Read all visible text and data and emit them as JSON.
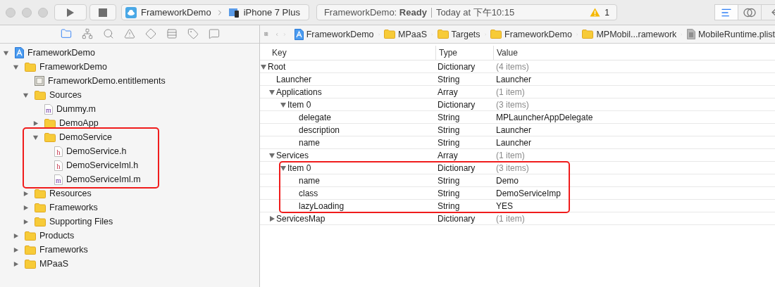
{
  "toolbar": {
    "scheme": "FrameworkDemo",
    "device": "iPhone 7 Plus",
    "status": "FrameworkDemo: **Ready**",
    "time": "Today at 下午10:15",
    "warnings": "1",
    "editor_modes": [
      {
        "kind": "standard",
        "selected": true
      },
      {
        "kind": "assistant",
        "selected": false
      },
      {
        "kind": "version",
        "selected": false
      }
    ]
  },
  "navigator_tabs": [
    {
      "kind": "project",
      "selected": true
    },
    {
      "kind": "symbol",
      "selected": false
    },
    {
      "kind": "find",
      "selected": false
    },
    {
      "kind": "issue",
      "selected": false
    },
    {
      "kind": "test",
      "selected": false
    },
    {
      "kind": "debug",
      "selected": false
    },
    {
      "kind": "breakpoint",
      "selected": false
    },
    {
      "kind": "report",
      "selected": false
    }
  ],
  "tree": [
    {
      "label": "FrameworkDemo",
      "kind": "project",
      "expanded": true,
      "highlighted": false,
      "children": [
        {
          "label": "FrameworkDemo",
          "kind": "folder",
          "expanded": true,
          "highlighted": false,
          "children": [
            {
              "label": "FrameworkDemo.entitlements",
              "kind": "entitlements",
              "highlighted": false
            },
            {
              "label": "Sources",
              "kind": "folder",
              "expanded": true,
              "highlighted": false,
              "children": [
                {
                  "label": "Dummy.m",
                  "kind": "source",
                  "letter": "m",
                  "highlighted": false
                },
                {
                  "label": "DemoApp",
                  "kind": "folder",
                  "expanded": false,
                  "highlighted": false
                },
                {
                  "label": "DemoService",
                  "kind": "folder",
                  "expanded": true,
                  "highlighted": true,
                  "children": [
                    {
                      "label": "DemoService.h",
                      "kind": "header",
                      "letter": "h",
                      "highlighted": false
                    },
                    {
                      "label": "DemoServiceIml.h",
                      "kind": "header",
                      "letter": "h",
                      "highlighted": false
                    },
                    {
                      "label": "DemoServiceIml.m",
                      "kind": "source",
                      "letter": "m",
                      "highlighted": false
                    }
                  ]
                }
              ]
            },
            {
              "label": "Resources",
              "kind": "folder",
              "expanded": false,
              "highlighted": false
            },
            {
              "label": "Frameworks",
              "kind": "folder",
              "expanded": false,
              "highlighted": false
            },
            {
              "label": "Supporting Files",
              "kind": "folder",
              "expanded": false,
              "highlighted": false
            }
          ]
        },
        {
          "label": "Products",
          "kind": "folder",
          "expanded": false,
          "highlighted": false
        },
        {
          "label": "Frameworks",
          "kind": "folder",
          "expanded": false,
          "highlighted": false
        },
        {
          "label": "MPaaS",
          "kind": "folder",
          "expanded": false,
          "highlighted": false
        }
      ]
    }
  ],
  "breadcrumb": [
    {
      "label": "FrameworkDemo",
      "kind": "project"
    },
    {
      "label": "MPaaS",
      "kind": "folder"
    },
    {
      "label": "Targets",
      "kind": "folder"
    },
    {
      "label": "FrameworkDemo",
      "kind": "folder"
    },
    {
      "label": "MPMobil...ramework",
      "kind": "folder"
    },
    {
      "label": "MobileRuntime.plist",
      "kind": "plist"
    }
  ],
  "plist": {
    "columns": [
      "Key",
      "Type",
      "Value"
    ],
    "rows": [
      {
        "key": "Root",
        "type": "Dictionary",
        "value": "(4 items)",
        "kind": "collection",
        "expanded": true,
        "highlighted": false,
        "children": [
          {
            "key": "Launcher",
            "type": "String",
            "value": "Launcher",
            "kind": "value",
            "highlighted": false
          },
          {
            "key": "Applications",
            "type": "Array",
            "value": "(1 item)",
            "kind": "collection",
            "expanded": true,
            "highlighted": false,
            "children": [
              {
                "key": "Item 0",
                "type": "Dictionary",
                "value": "(3 items)",
                "kind": "collection",
                "expanded": true,
                "highlighted": false,
                "children": [
                  {
                    "key": "delegate",
                    "type": "String",
                    "value": "MPLauncherAppDelegate",
                    "kind": "value",
                    "highlighted": false
                  },
                  {
                    "key": "description",
                    "type": "String",
                    "value": "Launcher",
                    "kind": "value",
                    "highlighted": false
                  },
                  {
                    "key": "name",
                    "type": "String",
                    "value": "Launcher",
                    "kind": "value",
                    "highlighted": false
                  }
                ]
              }
            ]
          },
          {
            "key": "Services",
            "type": "Array",
            "value": "(1 item)",
            "kind": "collection",
            "expanded": true,
            "highlighted": false,
            "children": [
              {
                "key": "Item 0",
                "type": "Dictionary",
                "value": "(3 items)",
                "kind": "collection",
                "expanded": true,
                "highlighted": true,
                "children": [
                  {
                    "key": "name",
                    "type": "String",
                    "value": "Demo",
                    "kind": "value",
                    "highlighted": false
                  },
                  {
                    "key": "class",
                    "type": "String",
                    "value": "DemoServiceImp",
                    "kind": "value",
                    "highlighted": false
                  },
                  {
                    "key": "lazyLoading",
                    "type": "String",
                    "value": "YES",
                    "kind": "value",
                    "highlighted": false
                  }
                ]
              }
            ]
          },
          {
            "key": "ServicesMap",
            "type": "Dictionary",
            "value": "(1 item)",
            "kind": "collection",
            "expanded": false,
            "highlighted": false
          }
        ]
      }
    ]
  }
}
